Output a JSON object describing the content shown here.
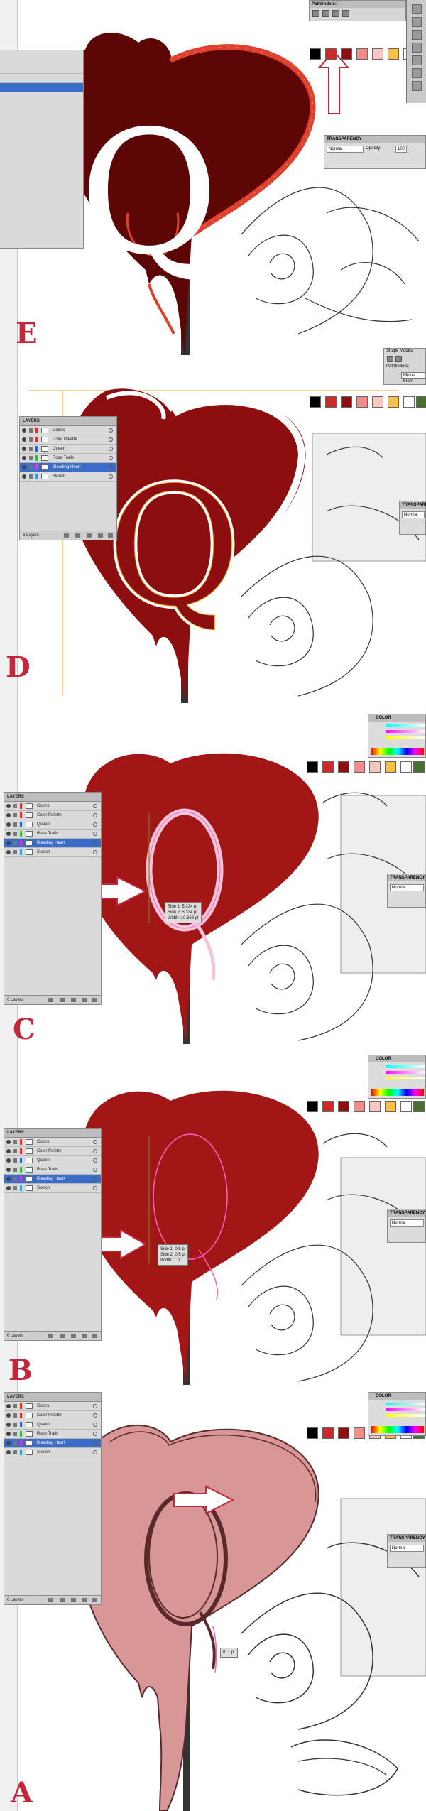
{
  "layers_panel": {
    "tab_label": "LAYERS",
    "layers": [
      {
        "name": "Colors",
        "chip": "#e03030"
      },
      {
        "name": "Color Palette",
        "chip": "#e03030"
      },
      {
        "name": "Queen",
        "chip": "#3060e0"
      },
      {
        "name": "Rose Trails",
        "chip": "#30c040"
      },
      {
        "name": "Bleeding Heart",
        "chip": "#d040d0"
      },
      {
        "name": "Sketch",
        "chip": "#30a0e0"
      }
    ],
    "selected_layer": "Bleeding Heart",
    "footer_count": "6 Layers"
  },
  "swatches": [
    "#000000",
    "#cc2a2a",
    "#8c1010",
    "#f08c8c",
    "#f8c8c0",
    "#f8c048",
    "#ffffff",
    "#4a7030"
  ],
  "transparency_panel": {
    "title": "TRANSPARENCY",
    "blend_mode": "Normal",
    "opacity_label": "Opacity:",
    "opacity_value": "100"
  },
  "pathfinder_panel": {
    "title": "Pathfinders:"
  },
  "shape_modes_panel": {
    "title": "Shape Modes:",
    "pathfinders_label": "Pathfinders:",
    "minus_front_label": "Minus Front"
  },
  "color_panel": {
    "title": "COLOR"
  },
  "steps": [
    {
      "letter": "E",
      "heart_color": "#5c0606"
    },
    {
      "letter": "D",
      "heart_color": "#8c0e0e"
    },
    {
      "letter": "C",
      "heart_color": "#a31616"
    },
    {
      "letter": "B",
      "heart_color": "#a31616"
    },
    {
      "letter": "A",
      "heart_color": "#d99696"
    }
  ],
  "readouts": {
    "step_c": [
      "Side 1: 5.334 pt",
      "Side 2: 5.334 pt",
      "Width: 10.668 pt"
    ],
    "step_b": [
      "Side 1: 0.5 pt",
      "Side 2: 0.5 pt",
      "Width: 1 pt"
    ],
    "step_a": "0: 1 pt"
  },
  "queen_letter": "Q"
}
